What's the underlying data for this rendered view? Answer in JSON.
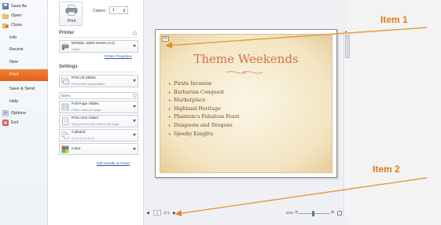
{
  "nav": {
    "items": [
      {
        "label": "Save As",
        "icon": "save-as-icon"
      },
      {
        "label": "Open",
        "icon": "open-icon"
      },
      {
        "label": "Close",
        "icon": "close-file-icon"
      },
      {
        "label": "Info"
      },
      {
        "label": "Recent"
      },
      {
        "label": "New"
      },
      {
        "label": "Print",
        "selected": true
      },
      {
        "label": "Save & Send"
      },
      {
        "label": "Help"
      },
      {
        "label": "Options",
        "icon": "options-icon"
      },
      {
        "label": "Exit",
        "icon": "exit-icon"
      }
    ]
  },
  "print_panel": {
    "print_label": "Print",
    "copies_label": "Copies:",
    "copies_value": "1",
    "printer_header": "Printer",
    "printer_name": "MODEL 23D0 Series (A1)",
    "printer_status": "Offline",
    "printer_properties_link": "Printer Properties",
    "settings_header": "Settings",
    "print_what_title": "Print All Slides",
    "print_what_sub": "Print entire presentation",
    "slides_label": "Slides:",
    "layout_title": "Full Page Slides",
    "layout_sub": "Print 1 slide per page",
    "sides_title": "Print One Sided",
    "sides_sub": "Only print on one side of the page",
    "collate_title": "Collated",
    "collate_sub": "1,2,3   1,2,3   1,2,3",
    "color_title": "Color",
    "edit_header_footer_link": "Edit Header & Footer"
  },
  "slide": {
    "number": "NN",
    "title": "Theme Weekends",
    "bullets": [
      "Pirate Invasion",
      "Barbarian Conquest",
      "Marketplace",
      "Highland Heritage",
      "Phantom's Fabulous Feast",
      "Dungeons and Dragons",
      "Spooky Knights"
    ]
  },
  "pager": {
    "prev": "◀",
    "current": "1",
    "of_total": "of 1",
    "next": "▶",
    "zoom": "53%"
  },
  "callouts": {
    "item1": "Item 1",
    "item2": "Item 2"
  },
  "colors": {
    "accent_orange": "#e07b18",
    "nav_selected": "#e3601a",
    "slide_title": "#d96f4c"
  }
}
